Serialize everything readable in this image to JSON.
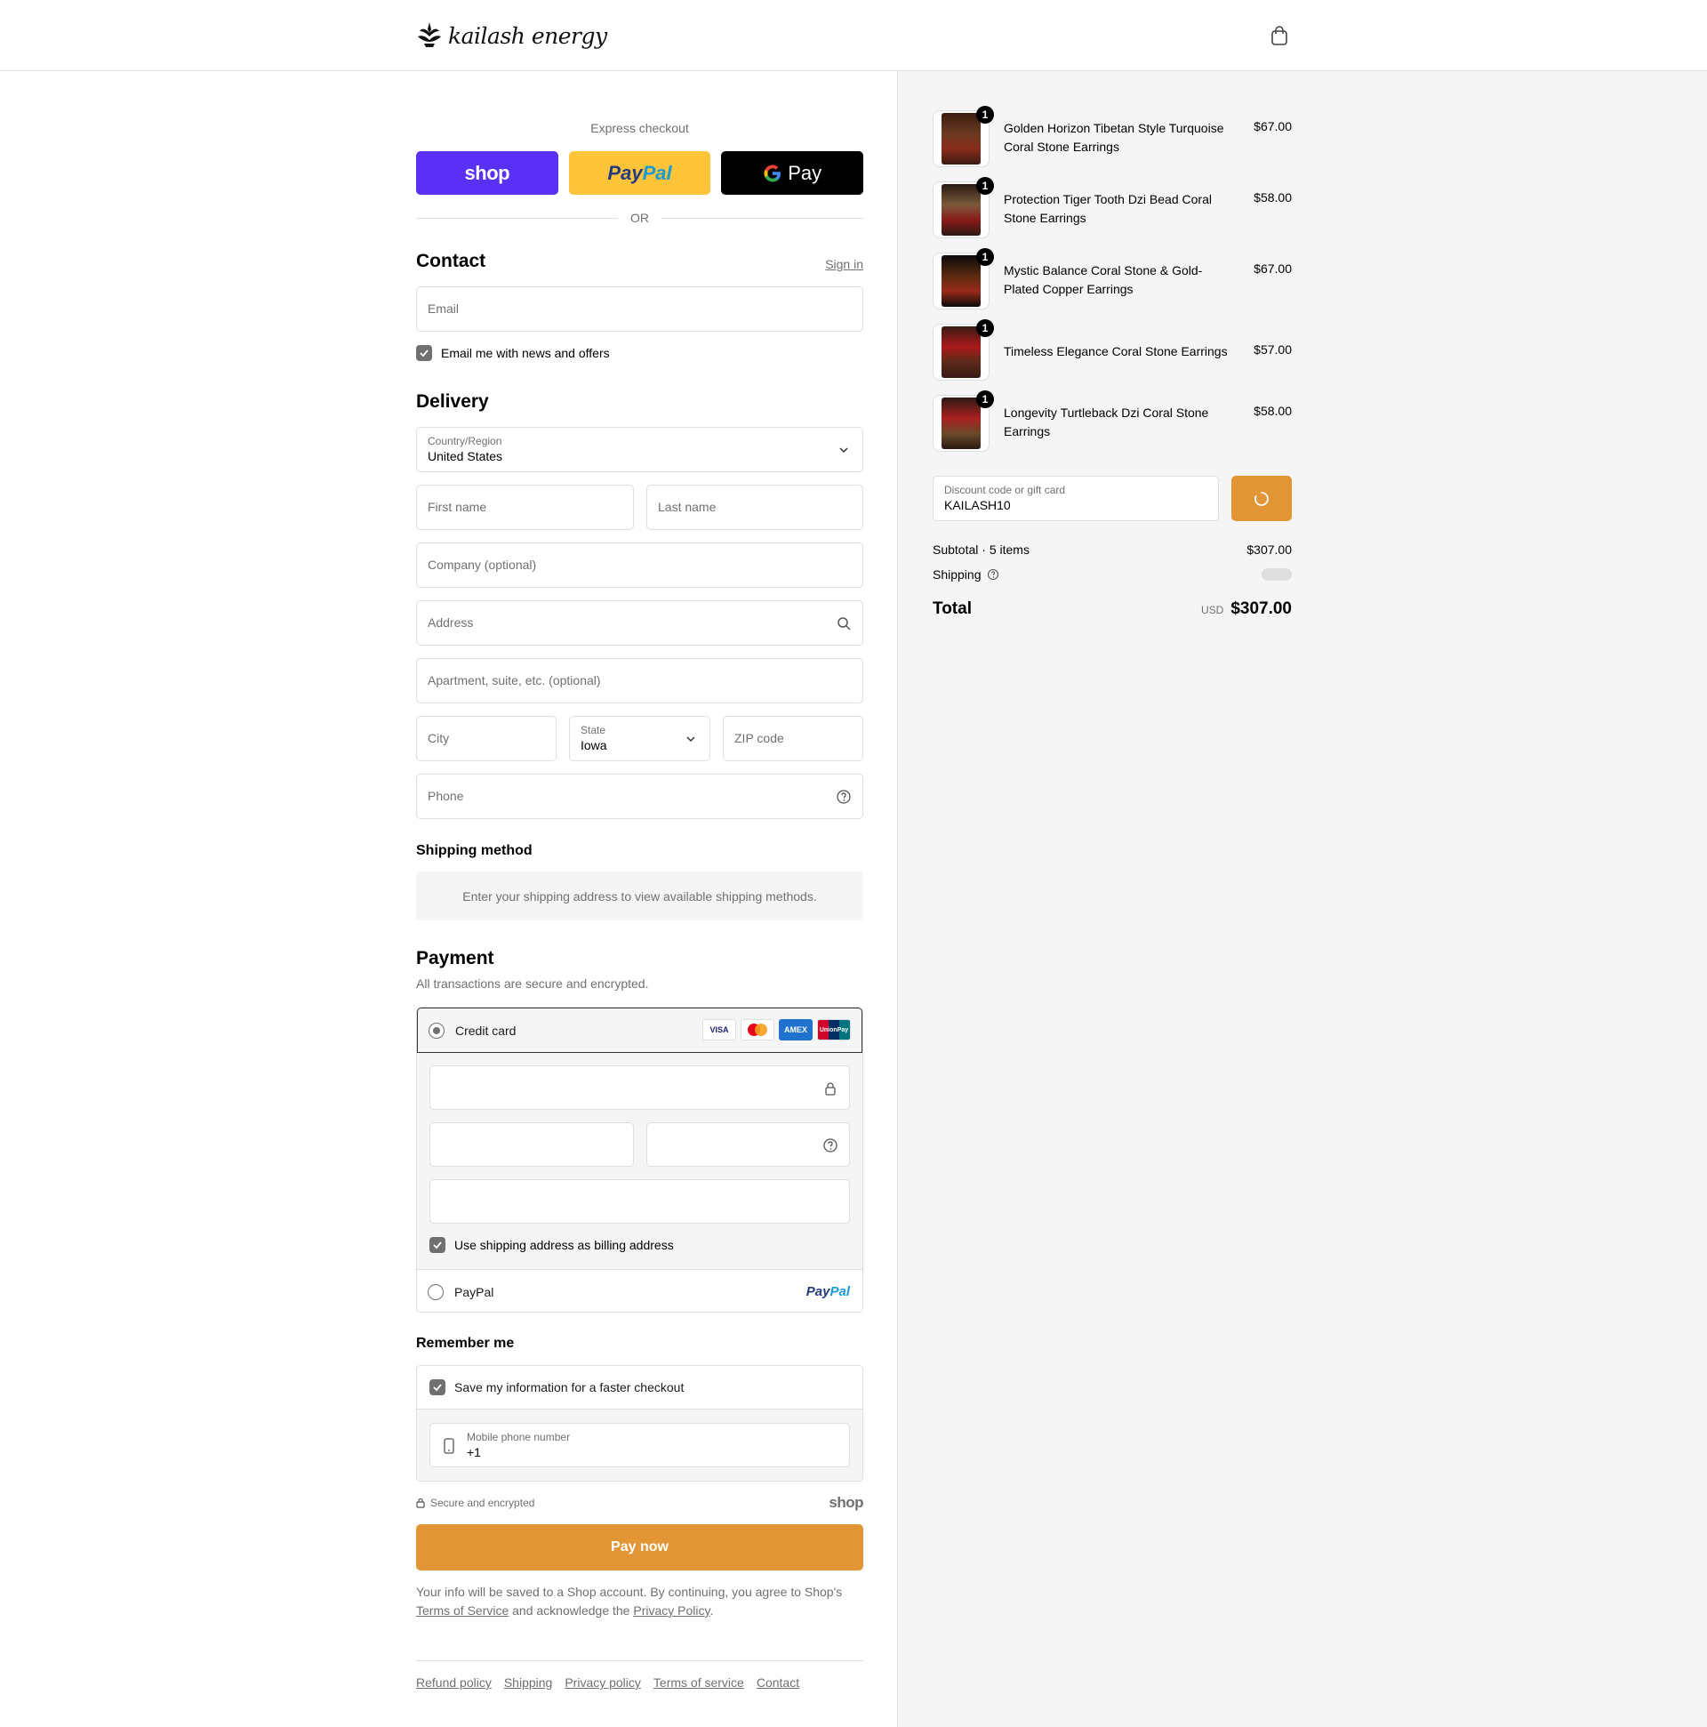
{
  "brand": {
    "name": "kailash energy"
  },
  "colors": {
    "accent": "#e29534",
    "shop": "#5a31f4",
    "paypal_yellow": "#ffc439",
    "muted": "#707070",
    "border": "#dedede"
  },
  "express": {
    "title": "Express checkout",
    "shop_label": "shop",
    "paypal_part1": "Pay",
    "paypal_part2": "Pal",
    "gpay_label": "Pay",
    "or_label": "OR"
  },
  "contact": {
    "title": "Contact",
    "sign_in": "Sign in",
    "email_placeholder": "Email",
    "news_checkbox": "Email me with news and offers"
  },
  "delivery": {
    "title": "Delivery",
    "country_label": "Country/Region",
    "country_value": "United States",
    "first_name": "First name",
    "last_name": "Last name",
    "company": "Company (optional)",
    "address": "Address",
    "apartment": "Apartment, suite, etc. (optional)",
    "city": "City",
    "state_label": "State",
    "state_value": "Iowa",
    "zip": "ZIP code",
    "phone": "Phone"
  },
  "shipping_method": {
    "title": "Shipping method",
    "notice": "Enter your shipping address to view available shipping methods."
  },
  "payment": {
    "title": "Payment",
    "subtitle": "All transactions are secure and encrypted.",
    "credit_card": "Credit card",
    "card_logos": [
      "VISA",
      "MC",
      "AMEX",
      "UnionPay"
    ],
    "billing_checkbox": "Use shipping address as billing address",
    "paypal_option": "PayPal",
    "paypal_logo_1": "Pay",
    "paypal_logo_2": "Pal"
  },
  "remember": {
    "title": "Remember me",
    "save_checkbox": "Save my information for a faster checkout",
    "phone_label": "Mobile phone number",
    "phone_value": "+1"
  },
  "secure": {
    "text": "Secure and encrypted",
    "shop_mark": "shop"
  },
  "pay_now": "Pay now",
  "legal": {
    "text1": "Your info will be saved to a Shop account. By continuing, you agree to Shop's",
    "terms": "Terms of Service",
    "text2": "and acknowledge the",
    "privacy": "Privacy Policy",
    "text3": "."
  },
  "footer_links": [
    "Refund policy",
    "Shipping",
    "Privacy policy",
    "Terms of service",
    "Contact"
  ],
  "cart": {
    "items": [
      {
        "name": "Golden Horizon Tibetan Style Turquoise Coral Stone Earrings",
        "price": "$67.00",
        "qty": "1"
      },
      {
        "name": "Protection Tiger Tooth Dzi Bead Coral Stone Earrings",
        "price": "$58.00",
        "qty": "1"
      },
      {
        "name": "Mystic Balance Coral Stone & Gold-Plated Copper Earrings",
        "price": "$67.00",
        "qty": "1"
      },
      {
        "name": "Timeless Elegance Coral Stone Earrings",
        "price": "$57.00",
        "qty": "1"
      },
      {
        "name": "Longevity Turtleback Dzi Coral Stone Earrings",
        "price": "$58.00",
        "qty": "1"
      }
    ],
    "discount_label": "Discount code or gift card",
    "discount_value": "KAILASH10",
    "subtotal_label": "Subtotal · 5 items",
    "subtotal_value": "$307.00",
    "shipping_label": "Shipping",
    "total_label": "Total",
    "currency": "USD",
    "total_value": "$307.00"
  }
}
